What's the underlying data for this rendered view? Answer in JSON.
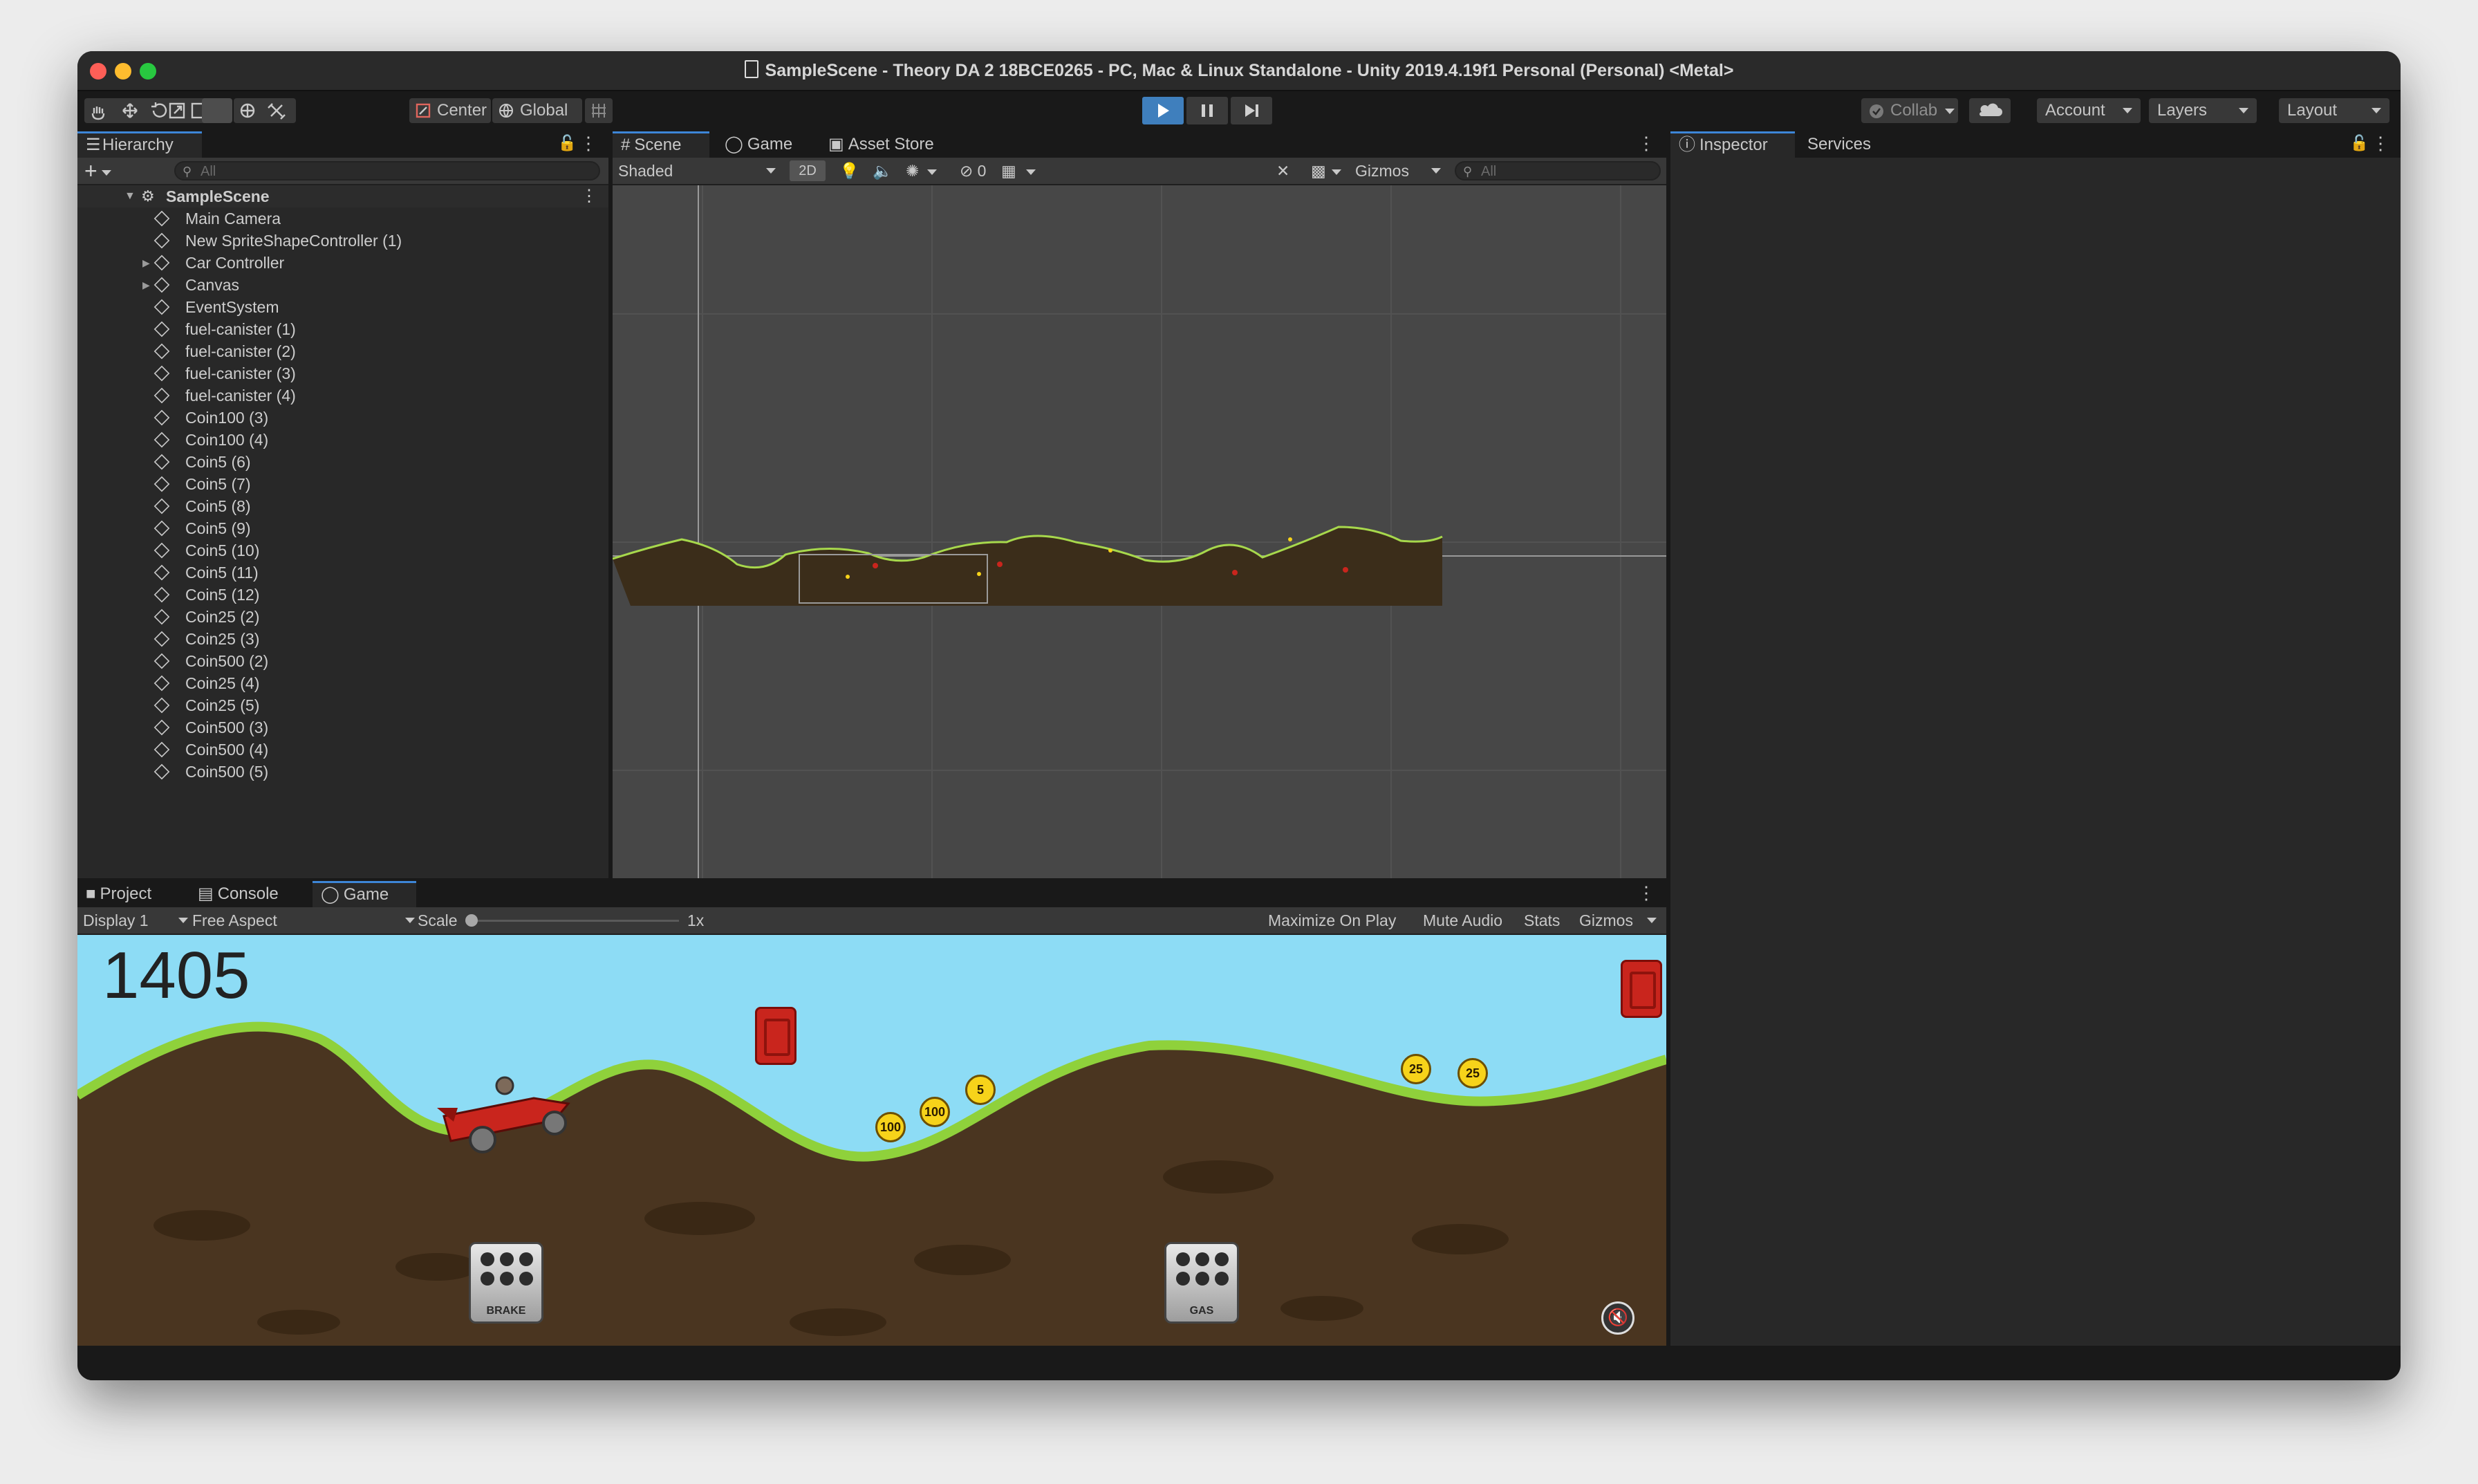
{
  "window": {
    "title": "SampleScene - Theory DA 2 18BCE0265 - PC, Mac & Linux Standalone - Unity 2019.4.19f1 Personal (Personal) <Metal>"
  },
  "toolbar": {
    "pivot_label": "Center",
    "space_label": "Global",
    "collab_label": "Collab",
    "account_label": "Account",
    "layers_label": "Layers",
    "layout_label": "Layout"
  },
  "hierarchy": {
    "tab_label": "Hierarchy",
    "search_placeholder": "All",
    "scene_name": "SampleScene",
    "items": [
      {
        "label": "Main Camera",
        "expandable": false
      },
      {
        "label": "New SpriteShapeController (1)",
        "expandable": false
      },
      {
        "label": "Car Controller",
        "expandable": true
      },
      {
        "label": "Canvas",
        "expandable": true
      },
      {
        "label": "EventSystem",
        "expandable": false
      },
      {
        "label": "fuel-canister (1)",
        "expandable": false
      },
      {
        "label": "fuel-canister (2)",
        "expandable": false
      },
      {
        "label": "fuel-canister (3)",
        "expandable": false
      },
      {
        "label": "fuel-canister (4)",
        "expandable": false
      },
      {
        "label": "Coin100 (3)",
        "expandable": false
      },
      {
        "label": "Coin100 (4)",
        "expandable": false
      },
      {
        "label": "Coin5 (6)",
        "expandable": false
      },
      {
        "label": "Coin5 (7)",
        "expandable": false
      },
      {
        "label": "Coin5 (8)",
        "expandable": false
      },
      {
        "label": "Coin5 (9)",
        "expandable": false
      },
      {
        "label": "Coin5 (10)",
        "expandable": false
      },
      {
        "label": "Coin5 (11)",
        "expandable": false
      },
      {
        "label": "Coin5 (12)",
        "expandable": false
      },
      {
        "label": "Coin25 (2)",
        "expandable": false
      },
      {
        "label": "Coin25 (3)",
        "expandable": false
      },
      {
        "label": "Coin500 (2)",
        "expandable": false
      },
      {
        "label": "Coin25 (4)",
        "expandable": false
      },
      {
        "label": "Coin25 (5)",
        "expandable": false
      },
      {
        "label": "Coin500 (3)",
        "expandable": false
      },
      {
        "label": "Coin500 (4)",
        "expandable": false
      },
      {
        "label": "Coin500 (5)",
        "expandable": false
      }
    ]
  },
  "scene_view": {
    "tabs": [
      "Scene",
      "Game",
      "Asset Store"
    ],
    "draw_mode": "Shaded",
    "mode_2d": "2D",
    "hidden_count": "0",
    "gizmos_label": "Gizmos",
    "search_placeholder": "All"
  },
  "inspector": {
    "tabs": [
      "Inspector",
      "Services"
    ]
  },
  "bottom_panel": {
    "tabs": [
      "Project",
      "Console",
      "Game"
    ],
    "display": "Display 1",
    "aspect": "Free Aspect",
    "scale_label": "Scale",
    "scale_value": "1x",
    "scale_fraction": 0.0,
    "buttons": [
      "Maximize On Play",
      "Mute Audio",
      "Stats",
      "Gizmos"
    ]
  },
  "game_view": {
    "score": "1405",
    "coins": [
      "100",
      "100",
      "5",
      "25",
      "25"
    ],
    "brake_label": "BRAKE",
    "gas_label": "GAS",
    "sky_color": "#8ddcf5",
    "ground_color": "#4a3520",
    "grass_color": "#8fd13b"
  },
  "colors": {
    "accent": "#3d86d7",
    "play_active": "#3f7fbd"
  }
}
